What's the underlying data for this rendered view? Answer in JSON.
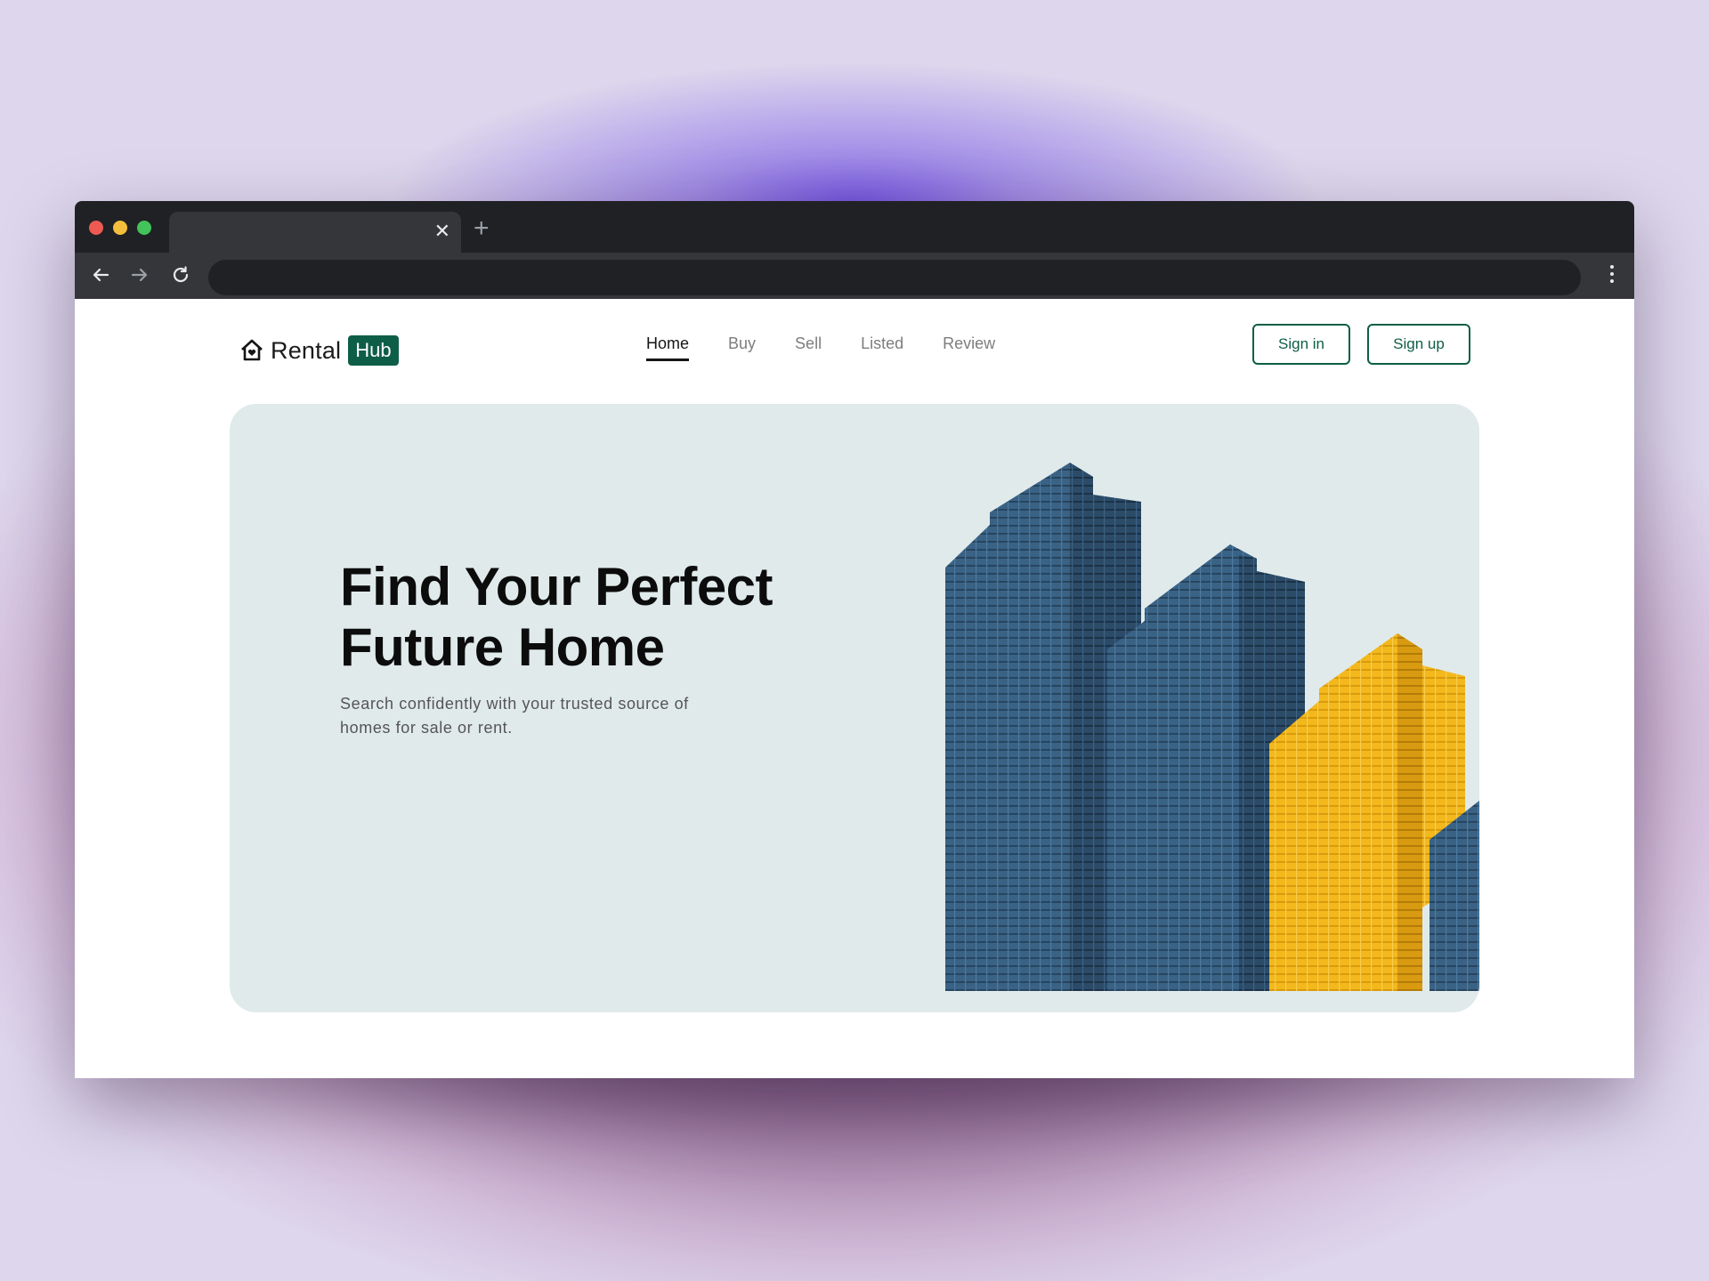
{
  "browser": {
    "tab_close": "✕",
    "new_tab": "+"
  },
  "site": {
    "logo_text": "Rental",
    "logo_badge": "Hub",
    "nav": [
      {
        "label": "Home",
        "active": true
      },
      {
        "label": "Buy",
        "active": false
      },
      {
        "label": "Sell",
        "active": false
      },
      {
        "label": "Listed",
        "active": false
      },
      {
        "label": "Review",
        "active": false
      }
    ],
    "signin_label": "Sign in",
    "signup_label": "Sign up"
  },
  "hero": {
    "title": "Find Your Perfect Future Home",
    "subtitle": "Search confidently with your trusted source of homes for sale or rent."
  },
  "colors": {
    "brand": "#0e5e47",
    "hero_bg": "#e0eaeb",
    "building_blue": "#3a6285",
    "building_yellow": "#f3b81c"
  },
  "icons": [
    "house-heart-icon",
    "back-arrow-icon",
    "forward-arrow-icon",
    "reload-icon",
    "more-vert-icon",
    "close-icon",
    "plus-icon"
  ]
}
